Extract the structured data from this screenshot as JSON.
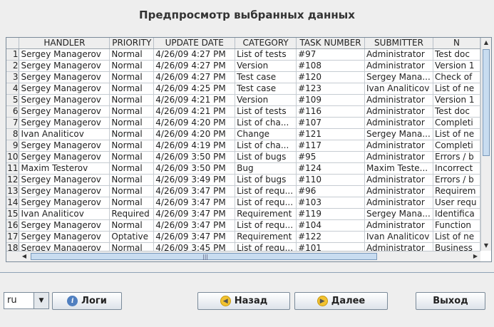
{
  "title": "Предпросмотр выбранных данных",
  "columns": [
    "HANDLER",
    "PRIORITY",
    "UPDATE DATE",
    "CATEGORY",
    "TASK NUMBER",
    "SUBMITTER",
    "N"
  ],
  "rows": [
    [
      "1",
      "Sergey Managerov",
      "Normal",
      "4/26/09 4:27 PM",
      "List of tests",
      "#97",
      "Administrator",
      "Test doc"
    ],
    [
      "2",
      "Sergey Managerov",
      "Normal",
      "4/26/09 4:27 PM",
      "Version",
      "#108",
      "Administrator",
      "Version 1"
    ],
    [
      "3",
      "Sergey Managerov",
      "Normal",
      "4/26/09 4:27 PM",
      "Test case",
      "#120",
      "Sergey Mana...",
      "Check of"
    ],
    [
      "4",
      "Sergey Managerov",
      "Normal",
      "4/26/09 4:25 PM",
      "Test case",
      "#123",
      "Ivan Analiticov",
      "List of ne"
    ],
    [
      "5",
      "Sergey Managerov",
      "Normal",
      "4/26/09 4:21 PM",
      "Version",
      "#109",
      "Administrator",
      "Version 1"
    ],
    [
      "6",
      "Sergey Managerov",
      "Normal",
      "4/26/09 4:21 PM",
      "List of tests",
      "#116",
      "Administrator",
      "Test doc"
    ],
    [
      "7",
      "Sergey Managerov",
      "Normal",
      "4/26/09 4:20 PM",
      "List of cha...",
      "#107",
      "Administrator",
      "Completi"
    ],
    [
      "8",
      "Ivan Analiticov",
      "Normal",
      "4/26/09 4:20 PM",
      "Change",
      "#121",
      "Sergey Mana...",
      "List of ne"
    ],
    [
      "9",
      "Sergey Managerov",
      "Normal",
      "4/26/09 4:19 PM",
      "List of cha...",
      "#117",
      "Administrator",
      "Completi"
    ],
    [
      "10",
      "Sergey Managerov",
      "Normal",
      "4/26/09 3:50 PM",
      "List of bugs",
      "#95",
      "Administrator",
      "Errors / b"
    ],
    [
      "11",
      "Maxim Testerov",
      "Normal",
      "4/26/09 3:50 PM",
      "Bug",
      "#124",
      "Maxim Teste...",
      "Incorrect"
    ],
    [
      "12",
      "Sergey Managerov",
      "Normal",
      "4/26/09 3:49 PM",
      "List of bugs",
      "#110",
      "Administrator",
      "Errors / b"
    ],
    [
      "13",
      "Sergey Managerov",
      "Normal",
      "4/26/09 3:47 PM",
      "List of requ...",
      "#96",
      "Administrator",
      "Requirem"
    ],
    [
      "14",
      "Sergey Managerov",
      "Normal",
      "4/26/09 3:47 PM",
      "List of requ...",
      "#103",
      "Administrator",
      "User requ"
    ],
    [
      "15",
      "Ivan Analiticov",
      "Required",
      "4/26/09 3:47 PM",
      "Requirement",
      "#119",
      "Sergey Mana...",
      "Identifica"
    ],
    [
      "16",
      "Sergey Managerov",
      "Normal",
      "4/26/09 3:47 PM",
      "List of requ...",
      "#104",
      "Administrator",
      "Function"
    ],
    [
      "17",
      "Sergey Managerov",
      "Optative",
      "4/26/09 3:47 PM",
      "Requirement",
      "#122",
      "Ivan Analiticov",
      "List of ne"
    ],
    [
      "18",
      "Sergey Managerov",
      "Normal",
      "4/26/09 3:45 PM",
      "List of requ...",
      "#101",
      "Administrator",
      "Business"
    ]
  ],
  "language": "ru",
  "buttons": {
    "logs": "Логи",
    "back": "Назад",
    "next": "Далее",
    "exit": "Выход"
  },
  "icons": {
    "logs": "info-icon",
    "back": "arrow-left-icon",
    "next": "arrow-right-icon"
  }
}
